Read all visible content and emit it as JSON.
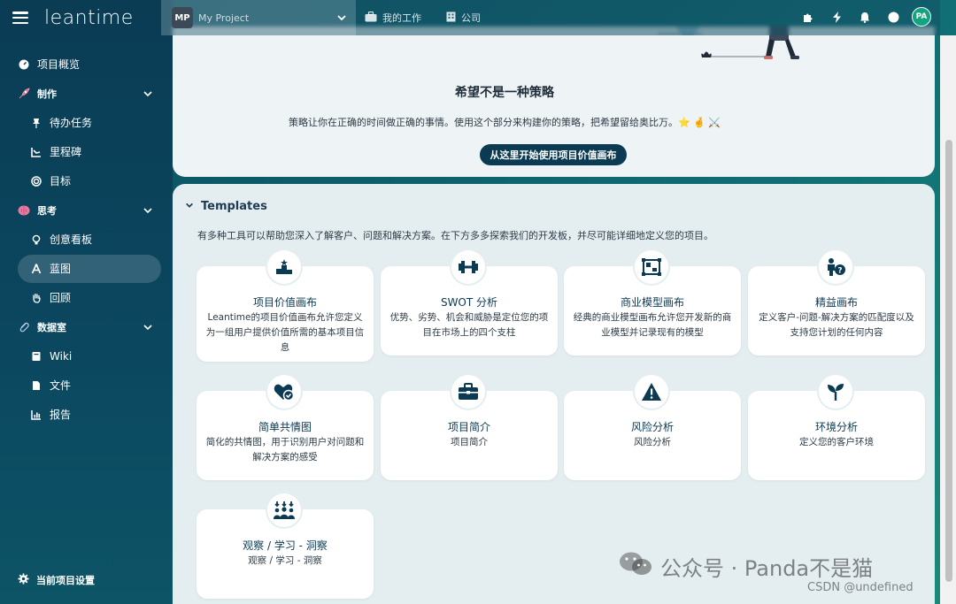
{
  "app": {
    "logo_text": "leantime"
  },
  "sidebar": {
    "items": [
      {
        "label": "项目概览",
        "kind": "item",
        "icon": "gauge-icon"
      },
      {
        "label": "制作",
        "kind": "section",
        "icon": "rocket-icon"
      },
      {
        "label": "待办任务",
        "kind": "child",
        "icon": "pin-icon"
      },
      {
        "label": "里程碑",
        "kind": "child",
        "icon": "chart-line-icon"
      },
      {
        "label": "目标",
        "kind": "child",
        "icon": "target-icon"
      },
      {
        "label": "思考",
        "kind": "section",
        "icon": "brain-icon"
      },
      {
        "label": "创意看板",
        "kind": "child",
        "icon": "lightbulb-icon"
      },
      {
        "label": "蓝图",
        "kind": "child",
        "icon": "compass-icon",
        "active": true
      },
      {
        "label": "回顾",
        "kind": "child",
        "icon": "hand-icon"
      },
      {
        "label": "数据室",
        "kind": "section",
        "icon": "paperclip-icon"
      },
      {
        "label": "Wiki",
        "kind": "child",
        "icon": "book-icon"
      },
      {
        "label": "文件",
        "kind": "child",
        "icon": "file-icon"
      },
      {
        "label": "报告",
        "kind": "child",
        "icon": "report-icon"
      }
    ],
    "settings_label": "当前项目设置"
  },
  "header": {
    "project_badge": "MP",
    "project_name": "My Project",
    "my_work": "我的工作",
    "company": "公司"
  },
  "user": {
    "initials": "PA"
  },
  "strategy": {
    "title": "希望不是一种策略",
    "desc": "策略让你在正确的时间做正确的事情。使用这个部分来构建你的策略，把希望留给奥比万。⭐ 🤞 ⚔️",
    "button": "从这里开始使用项目价值画布"
  },
  "templates": {
    "heading": "Templates",
    "desc": "有多种工具可以帮助您深入了解客户、问题和解决方案。在下方多多探索我们的开发板，并尽可能详细地定义您的项目。",
    "cards": [
      {
        "title": "项目价值画布",
        "desc": "Leantime的项目价值画布允许您定义为一组用户提供价值所需的基本项目信息",
        "icon": "podium-icon"
      },
      {
        "title": "SWOT 分析",
        "desc": "优势、劣势、机会和威胁是定位您的项目在市场上的四个支柱",
        "icon": "dumbbell-icon"
      },
      {
        "title": "商业模型画布",
        "desc": "经典的商业模型画布允许您开发新的商业模型并记录现有的模型",
        "icon": "canvas-icon"
      },
      {
        "title": "精益画布",
        "desc": "定义客户-问题-解决方案的匹配度以及支持您计划的任何内容",
        "icon": "person-question-icon"
      },
      {
        "title": "简单共情图",
        "desc": "简化的共情图，用于识别用户对问题和解决方案的感受",
        "icon": "heart-check-icon"
      },
      {
        "title": "项目简介",
        "desc": "项目简介",
        "icon": "briefcase-icon"
      },
      {
        "title": "风险分析",
        "desc": "风险分析",
        "icon": "warning-icon"
      },
      {
        "title": "环境分析",
        "desc": "定义您的客户环境",
        "icon": "seedling-icon"
      },
      {
        "title": "观察 / 学习 - 洞察",
        "desc": "观察 / 学习 - 洞察",
        "icon": "people-arrows-icon"
      }
    ]
  },
  "watermark": {
    "text": "公众号 · Panda不是猫",
    "csdn": "CSDN @undefined"
  }
}
